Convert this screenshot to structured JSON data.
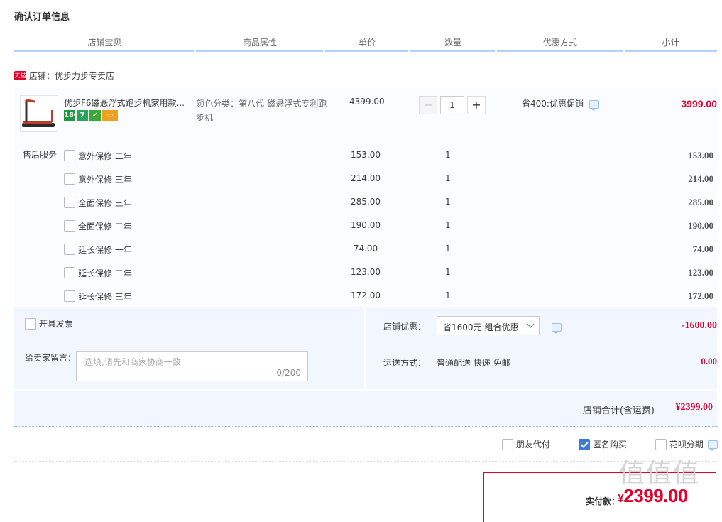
{
  "title": "确认订单信息",
  "columns": [
    "店铺宝贝",
    "商品属性",
    "单价",
    "数量",
    "优惠方式",
    "小计"
  ],
  "shop": {
    "badge": "天猫",
    "label": "店铺：优步力步专卖店"
  },
  "item": {
    "title": "优步F6磁悬浮式跑步机家用款...",
    "attr": "颜色分类：第八代-磁悬浮式专利跑步机",
    "price": "4399.00",
    "quantity": "1",
    "minus": "−",
    "plus": "+",
    "promo": "省400:优惠促销",
    "subtotal": "3999.00",
    "icons": [
      "180",
      "7",
      "credit-card-icon"
    ]
  },
  "services": {
    "label": "售后服务",
    "rows": [
      {
        "name": "意外保修  二年",
        "price": "153.00",
        "qty": "1",
        "subtotal": "153.00"
      },
      {
        "name": "意外保修  三年",
        "price": "214.00",
        "qty": "1",
        "subtotal": "214.00"
      },
      {
        "name": "全面保修  三年",
        "price": "285.00",
        "qty": "1",
        "subtotal": "285.00"
      },
      {
        "name": "全面保修  二年",
        "price": "190.00",
        "qty": "1",
        "subtotal": "190.00"
      },
      {
        "name": "延长保修  一年",
        "price": "74.00",
        "qty": "1",
        "subtotal": "74.00"
      },
      {
        "name": "延长保修  二年",
        "price": "123.00",
        "qty": "1",
        "subtotal": "123.00"
      },
      {
        "name": "延长保修  三年",
        "price": "172.00",
        "qty": "1",
        "subtotal": "172.00"
      }
    ]
  },
  "invoice": {
    "label": "开具发票"
  },
  "memo": {
    "label": "给卖家留言：",
    "placeholder": "选填,请先和商家协商一致",
    "count": "0/200"
  },
  "shop_discount": {
    "label": "店铺优惠：",
    "selected": "省1600元:组合优惠",
    "value": "-1600.00"
  },
  "shipping": {
    "label": "运送方式：",
    "value": "普通配送 快递 免邮",
    "fee": "0.00"
  },
  "shop_total": {
    "label": "店铺合计(含运费)",
    "value": "¥2399.00"
  },
  "options": [
    {
      "label": "朋友代付",
      "checked": false
    },
    {
      "label": "匿名购买",
      "checked": true
    },
    {
      "label": "花呗分期",
      "checked": false
    }
  ],
  "payment": {
    "label": "实付款：",
    "currency": "¥",
    "value": "2399.00"
  },
  "watermark": "值值值",
  "colors": {
    "accent": "#e4002b",
    "header_line": "#b2d1ff",
    "panel_bg": "#f2f7ff",
    "check": "#3a7bd5"
  }
}
